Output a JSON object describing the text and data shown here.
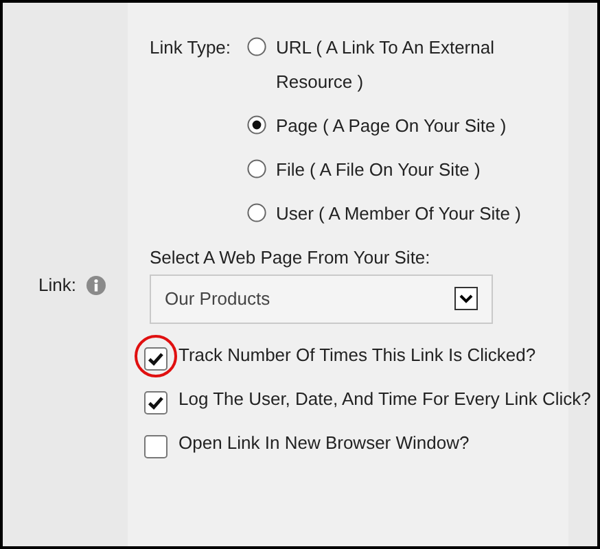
{
  "link_label": "Link:",
  "link_type": {
    "label": "Link Type:",
    "options": [
      {
        "label": "URL ( A Link To An External Resource )",
        "selected": false
      },
      {
        "label": "Page ( A Page On Your Site )",
        "selected": true
      },
      {
        "label": "File ( A File On Your Site )",
        "selected": false
      },
      {
        "label": "User ( A Member Of Your Site )",
        "selected": false
      }
    ]
  },
  "page_select": {
    "label": "Select A Web Page From Your Site:",
    "value": "Our Products"
  },
  "checkboxes": [
    {
      "label": "Track Number Of Times This Link Is Clicked?",
      "checked": true,
      "highlighted": true
    },
    {
      "label": "Log The User, Date, And Time For Every Link Click?",
      "checked": true,
      "highlighted": false
    },
    {
      "label": "Open Link In New Browser Window?",
      "checked": false,
      "highlighted": false
    }
  ]
}
